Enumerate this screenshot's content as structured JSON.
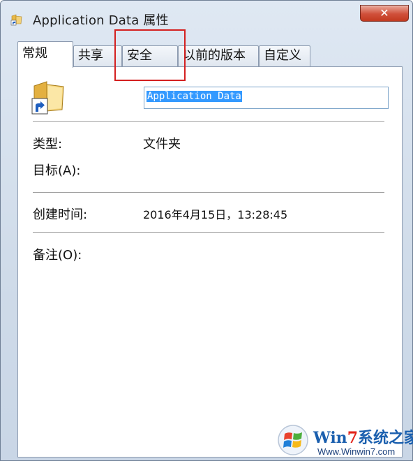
{
  "window": {
    "title": "Application Data 属性",
    "close_label": "✕"
  },
  "tabs": [
    {
      "label": "常规",
      "active": true
    },
    {
      "label": "共享",
      "active": false
    },
    {
      "label": "安全",
      "active": false
    },
    {
      "label": "以前的版本",
      "active": false
    },
    {
      "label": "自定义",
      "active": false
    }
  ],
  "general": {
    "folder_name": "Application Data",
    "type_label": "类型:",
    "type_value": "文件夹",
    "target_label": "目标(A):",
    "created_label": "创建时间:",
    "created_value": "2016年4月15日，13:28:45",
    "comment_label": "备注(O):"
  },
  "watermark": {
    "brand_prefix": "Win",
    "brand_seven": "7",
    "brand_suffix": "系统之家",
    "url": "Www.Winwin7.com"
  },
  "colors": {
    "highlight": "#d42020",
    "selection": "#3399ff",
    "close_button": "#c2391f"
  }
}
